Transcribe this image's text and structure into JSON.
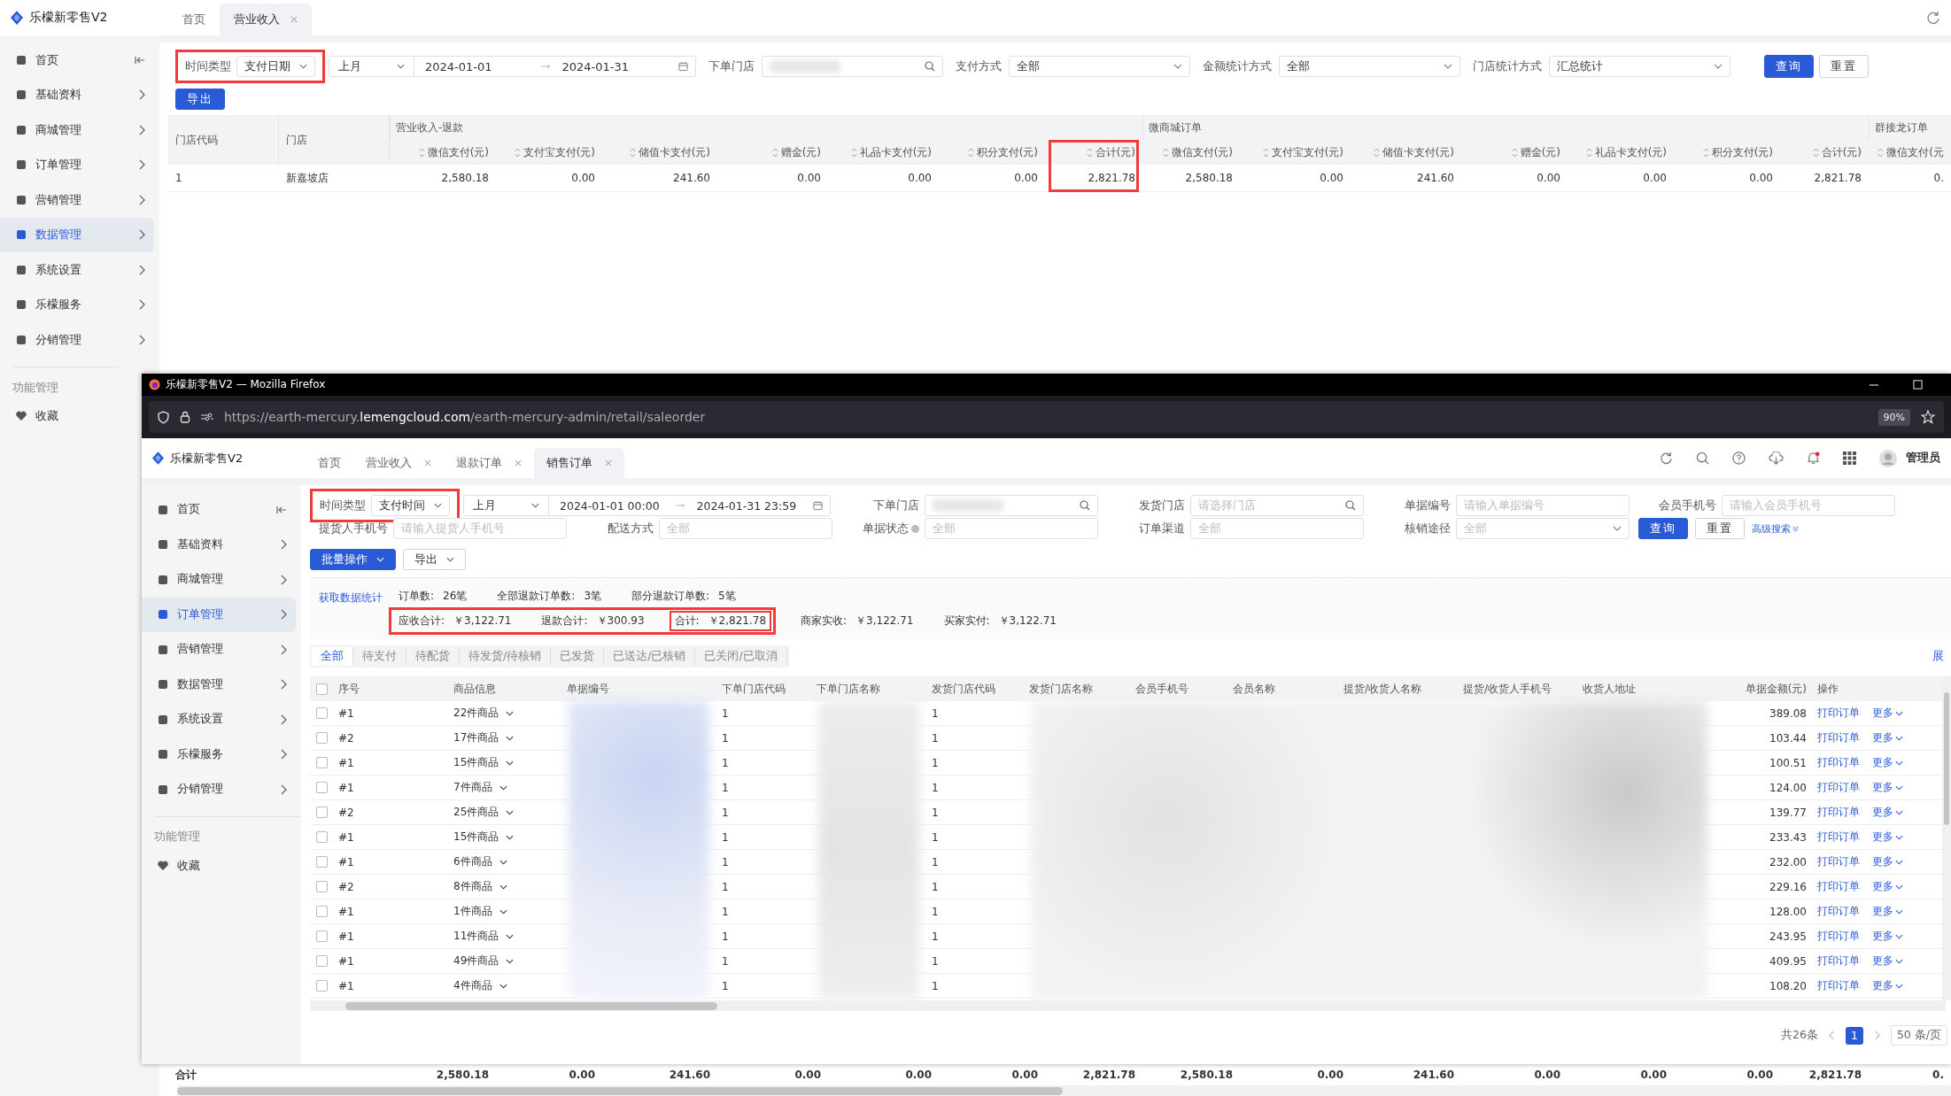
{
  "background_app": {
    "logo": "乐檬新零售V2",
    "tabs": [
      {
        "label": "首页",
        "selected": false,
        "closable": false
      },
      {
        "label": "营业收入",
        "selected": true,
        "closable": true
      }
    ],
    "sidebar": {
      "items": [
        {
          "label": "首页",
          "selected": false
        },
        {
          "label": "基础资料",
          "selected": false
        },
        {
          "label": "商城管理",
          "selected": false
        },
        {
          "label": "订单管理",
          "selected": false
        },
        {
          "label": "营销管理",
          "selected": false
        },
        {
          "label": "数据管理",
          "selected": true
        },
        {
          "label": "系统设置",
          "selected": false
        },
        {
          "label": "乐檬服务",
          "selected": false
        },
        {
          "label": "分销管理",
          "selected": false
        }
      ],
      "section_title": "功能管理",
      "favorites": [
        {
          "label": "收藏"
        }
      ]
    },
    "filters": [
      {
        "kind": "time-filter",
        "label": "时间类型",
        "type_value": "支付日期",
        "highlighted": true,
        "preset": "上月",
        "start": "2024-01-01",
        "end": "2024-01-31"
      },
      {
        "kind": "search",
        "label": "下单门店",
        "redacted": true
      },
      {
        "kind": "select",
        "label": "支付方式",
        "value": "全部"
      },
      {
        "kind": "select",
        "label": "金额统计方式",
        "value": "全部"
      },
      {
        "kind": "select",
        "label": "门店统计方式",
        "value": "汇总统计"
      }
    ],
    "buttons": [
      {
        "label": "查询",
        "primary": true
      },
      {
        "label": "重置",
        "primary": false
      }
    ],
    "export_button": "导出",
    "table": {
      "groups": [
        {
          "label": "营业收入-退款"
        },
        {
          "label": "微商城订单"
        },
        {
          "label": "群接龙订单"
        }
      ],
      "columns": [
        {
          "label": "门店代码",
          "sortable": false,
          "highlighted": false
        },
        {
          "label": "门店",
          "sortable": false,
          "highlighted": false
        },
        {
          "label": "微信支付(元)",
          "sortable": true,
          "highlighted": false
        },
        {
          "label": "支付宝支付(元)",
          "sortable": true,
          "highlighted": false
        },
        {
          "label": "储值卡支付(元)",
          "sortable": true,
          "highlighted": false
        },
        {
          "label": "赠金(元)",
          "sortable": true,
          "highlighted": false
        },
        {
          "label": "礼品卡支付(元)",
          "sortable": true,
          "highlighted": false
        },
        {
          "label": "积分支付(元)",
          "sortable": true,
          "highlighted": false
        },
        {
          "label": "合计(元)",
          "sortable": true,
          "highlighted": true
        },
        {
          "label": "微信支付(元)",
          "sortable": true,
          "highlighted": false
        },
        {
          "label": "支付宝支付(元)",
          "sortable": true,
          "highlighted": false
        },
        {
          "label": "储值卡支付(元)",
          "sortable": true,
          "highlighted": false
        },
        {
          "label": "赠金(元)",
          "sortable": true,
          "highlighted": false
        },
        {
          "label": "礼品卡支付(元)",
          "sortable": true,
          "highlighted": false
        },
        {
          "label": "积分支付(元)",
          "sortable": true,
          "highlighted": false
        },
        {
          "label": "合计(元)",
          "sortable": true,
          "highlighted": false
        },
        {
          "label": "微信支付(元",
          "sortable": true,
          "highlighted": false
        }
      ],
      "rows": [
        {
          "cells": [
            "1",
            "新嘉坡店",
            "2,580.18",
            "0.00",
            "241.60",
            "0.00",
            "0.00",
            "0.00",
            "2,821.78",
            "2,580.18",
            "0.00",
            "241.60",
            "0.00",
            "0.00",
            "0.00",
            "2,821.78",
            "0."
          ]
        }
      ],
      "totals": {
        "label": "合计",
        "values": [
          "2,580.18",
          "0.00",
          "241.60",
          "0.00",
          "0.00",
          "0.00",
          "2,821.78",
          "2,580.18",
          "0.00",
          "241.60",
          "0.00",
          "0.00",
          "0.00",
          "2,821.78",
          "0."
        ]
      }
    }
  },
  "browser_window": {
    "title": "乐檬新零售V2 — Mozilla Firefox",
    "url": {
      "prefix": "https://earth-mercury.",
      "domain": "lemengcloud.com",
      "suffix": "/earth-mercury-admin/retail/saleorder"
    },
    "zoom": "90%",
    "app": {
      "logo": "乐檬新零售V2",
      "tabs": [
        {
          "label": "首页",
          "selected": false,
          "closable": false
        },
        {
          "label": "营业收入",
          "selected": false,
          "closable": true
        },
        {
          "label": "退款订单",
          "selected": false,
          "closable": true
        },
        {
          "label": "销售订单",
          "selected": true,
          "closable": true
        }
      ],
      "notifications_unread": true,
      "user": "管理员",
      "sidebar": {
        "items": [
          {
            "label": "首页",
            "selected": false
          },
          {
            "label": "基础资料",
            "selected": false
          },
          {
            "label": "商城管理",
            "selected": false
          },
          {
            "label": "订单管理",
            "selected": true
          },
          {
            "label": "营销管理",
            "selected": false
          },
          {
            "label": "数据管理",
            "selected": false
          },
          {
            "label": "系统设置",
            "selected": false
          },
          {
            "label": "乐檬服务",
            "selected": false
          },
          {
            "label": "分销管理",
            "selected": false
          }
        ],
        "section_title": "功能管理",
        "favorites": [
          {
            "label": "收藏"
          }
        ]
      },
      "filter_rows": [
        [
          {
            "kind": "time-filter",
            "label": "时间类型",
            "type_value": "支付时间",
            "highlighted": true,
            "preset": "上月",
            "start": "2024-01-01 00:00",
            "end": "2024-01-31 23:59"
          },
          {
            "kind": "search",
            "label": "下单门店",
            "redacted": true
          },
          {
            "kind": "search",
            "label": "发货门店",
            "placeholder": "请选择门店"
          },
          {
            "kind": "text",
            "label": "单据编号",
            "placeholder": "请输入单据编号"
          },
          {
            "kind": "text",
            "label": "会员手机号",
            "placeholder": "请输入会员手机号"
          }
        ],
        [
          {
            "kind": "text",
            "label": "提货人手机号",
            "placeholder": "请输入提货人手机号"
          },
          {
            "kind": "text",
            "label": "配送方式",
            "placeholder": "全部"
          },
          {
            "kind": "text",
            "label": "单据状态",
            "placeholder": "全部",
            "info": true
          },
          {
            "kind": "text",
            "label": "订单渠道",
            "placeholder": "全部"
          },
          {
            "kind": "select",
            "label": "核销途径",
            "placeholder": "全部"
          }
        ]
      ],
      "search_buttons": [
        {
          "label": "查询",
          "primary": true
        },
        {
          "label": "重置",
          "primary": false
        }
      ],
      "advanced_search": "高级搜索",
      "action_buttons": [
        {
          "label": "批量操作",
          "primary": true
        },
        {
          "label": "导出",
          "primary": false
        }
      ],
      "stats": {
        "link": "获取数据统计",
        "counts": [
          {
            "label": "订单数:",
            "value": "26笔"
          },
          {
            "label": "全部退款订单数:",
            "value": "3笔"
          },
          {
            "label": "部分退款订单数:",
            "value": "5笔"
          }
        ],
        "framed": {
          "highlighted": true,
          "items": [
            {
              "label": "应收合计:",
              "value": "￥3,122.71",
              "highlighted": false
            },
            {
              "label": "退款合计:",
              "value": "￥300.93",
              "highlighted": false
            },
            {
              "label": "合计:",
              "value": "￥2,821.78",
              "highlighted": true
            }
          ]
        },
        "others": [
          {
            "label": "商家实收:",
            "value": "￥3,122.71"
          },
          {
            "label": "买家实付:",
            "value": "￥3,122.71"
          }
        ]
      },
      "status_tabs": [
        {
          "label": "全部",
          "selected": true
        },
        {
          "label": "待支付",
          "selected": false
        },
        {
          "label": "待配货",
          "selected": false
        },
        {
          "label": "待发货/待核销",
          "selected": false
        },
        {
          "label": "已发货",
          "selected": false
        },
        {
          "label": "已送达/已核销",
          "selected": false
        },
        {
          "label": "已关闭/已取消",
          "selected": false
        }
      ],
      "expand_link": "展",
      "table": {
        "header_checkbox": {
          "checked": false
        },
        "columns": [
          "序号",
          "商品信息",
          "单据编号",
          "下单门店代码",
          "下单门店名称",
          "发货门店代码",
          "发货门店名称",
          "会员手机号",
          "会员名称",
          "提货/收货人名称",
          "提货/收货人手机号",
          "收货人地址",
          "单据金额(元)",
          "操作"
        ],
        "rows": [
          {
            "checked": false,
            "index": "#1",
            "goods": "22件商品",
            "store_code": "1",
            "ship_store_code": "1",
            "amount": "389.08",
            "actions": [
              "打印订单",
              "更多"
            ]
          },
          {
            "checked": false,
            "index": "#2",
            "goods": "17件商品",
            "store_code": "1",
            "ship_store_code": "1",
            "amount": "103.44",
            "actions": [
              "打印订单",
              "更多"
            ]
          },
          {
            "checked": false,
            "index": "#1",
            "goods": "15件商品",
            "store_code": "1",
            "ship_store_code": "1",
            "amount": "100.51",
            "actions": [
              "打印订单",
              "更多"
            ]
          },
          {
            "checked": false,
            "index": "#1",
            "goods": "7件商品",
            "store_code": "1",
            "ship_store_code": "1",
            "amount": "124.00",
            "actions": [
              "打印订单",
              "更多"
            ]
          },
          {
            "checked": false,
            "index": "#2",
            "goods": "25件商品",
            "store_code": "1",
            "ship_store_code": "1",
            "amount": "139.77",
            "actions": [
              "打印订单",
              "更多"
            ]
          },
          {
            "checked": false,
            "index": "#1",
            "goods": "15件商品",
            "store_code": "1",
            "ship_store_code": "1",
            "amount": "233.43",
            "actions": [
              "打印订单",
              "更多"
            ]
          },
          {
            "checked": false,
            "index": "#1",
            "goods": "6件商品",
            "store_code": "1",
            "ship_store_code": "1",
            "amount": "232.00",
            "actions": [
              "打印订单",
              "更多"
            ]
          },
          {
            "checked": false,
            "index": "#2",
            "goods": "8件商品",
            "store_code": "1",
            "ship_store_code": "1",
            "amount": "229.16",
            "actions": [
              "打印订单",
              "更多"
            ]
          },
          {
            "checked": false,
            "index": "#1",
            "goods": "1件商品",
            "store_code": "1",
            "ship_store_code": "1",
            "amount": "128.00",
            "actions": [
              "打印订单",
              "更多"
            ]
          },
          {
            "checked": false,
            "index": "#1",
            "goods": "11件商品",
            "store_code": "1",
            "ship_store_code": "1",
            "amount": "243.95",
            "actions": [
              "打印订单",
              "更多"
            ]
          },
          {
            "checked": false,
            "index": "#1",
            "goods": "49件商品",
            "store_code": "1",
            "ship_store_code": "1",
            "amount": "409.95",
            "actions": [
              "打印订单",
              "更多"
            ]
          },
          {
            "checked": false,
            "index": "#1",
            "goods": "4件商品",
            "store_code": "1",
            "ship_store_code": "1",
            "amount": "108.20",
            "actions": [
              "打印订单",
              "更多"
            ]
          }
        ]
      },
      "pagination": {
        "total": "共26条",
        "pages": [
          {
            "label": "1",
            "selected": true
          }
        ],
        "page_size": "50 条/页"
      }
    }
  }
}
